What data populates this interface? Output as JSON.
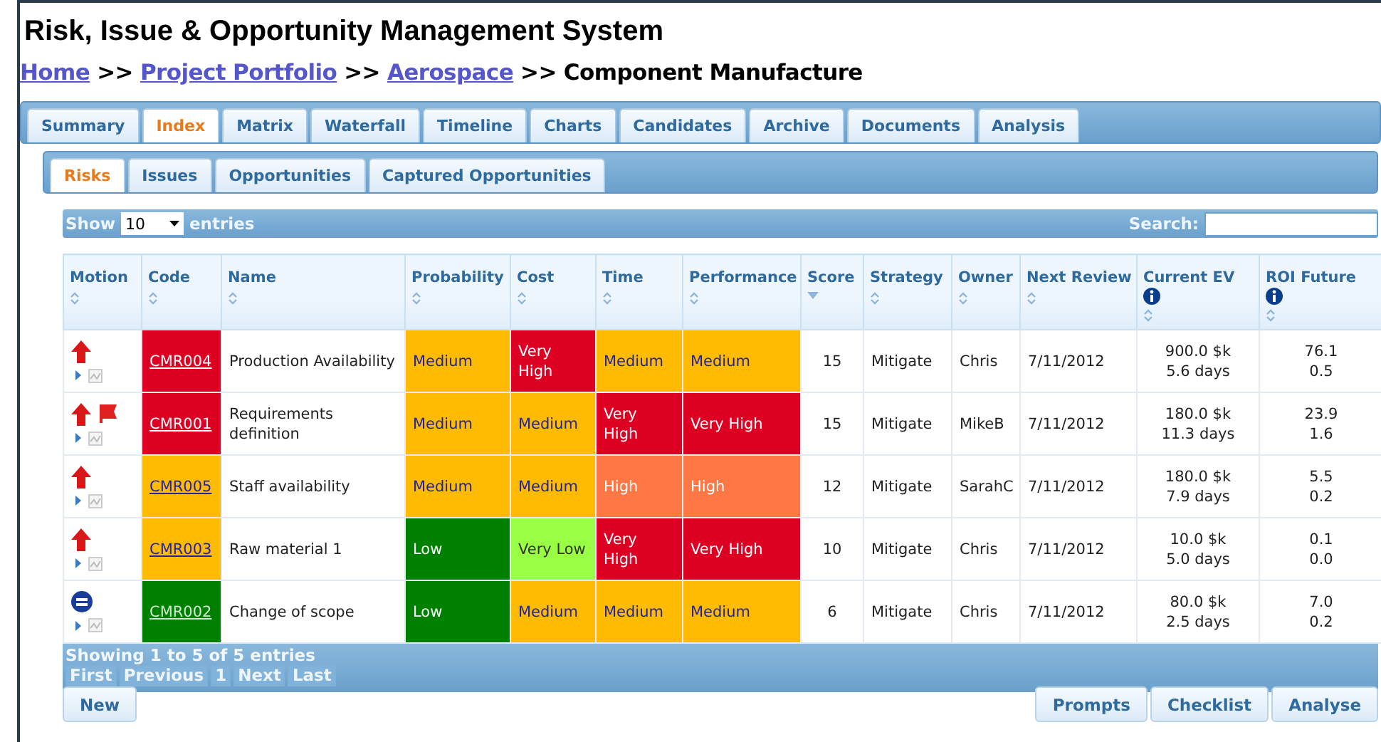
{
  "title": "Risk, Issue & Opportunity Management System",
  "breadcrumb": [
    {
      "label": "Home",
      "link": true
    },
    {
      "label": "Project Portfolio",
      "link": true
    },
    {
      "label": "Aerospace",
      "link": true
    },
    {
      "label": "Component Manufacture",
      "link": false
    }
  ],
  "separator": ">>",
  "tabs": [
    {
      "label": "Summary",
      "selected": false
    },
    {
      "label": "Index",
      "selected": true
    },
    {
      "label": "Matrix",
      "selected": false
    },
    {
      "label": "Waterfall",
      "selected": false
    },
    {
      "label": "Timeline",
      "selected": false
    },
    {
      "label": "Charts",
      "selected": false
    },
    {
      "label": "Candidates",
      "selected": false
    },
    {
      "label": "Archive",
      "selected": false
    },
    {
      "label": "Documents",
      "selected": false
    },
    {
      "label": "Analysis",
      "selected": false
    }
  ],
  "subtabs": [
    {
      "label": "Risks",
      "selected": true
    },
    {
      "label": "Issues",
      "selected": false
    },
    {
      "label": "Opportunities",
      "selected": false
    },
    {
      "label": "Captured Opportunities",
      "selected": false
    }
  ],
  "length_control": {
    "before": "Show",
    "value": "10",
    "after": "entries"
  },
  "search": {
    "label": "Search:"
  },
  "table": {
    "columns": [
      {
        "label": "Motion",
        "sorted": false,
        "info": false
      },
      {
        "label": "Code",
        "sorted": false,
        "info": false
      },
      {
        "label": "Name",
        "sorted": false,
        "info": false
      },
      {
        "label": "Probability",
        "sorted": false,
        "info": false
      },
      {
        "label": "Cost",
        "sorted": false,
        "info": false
      },
      {
        "label": "Time",
        "sorted": false,
        "info": false
      },
      {
        "label": "Performance",
        "sorted": false,
        "info": false
      },
      {
        "label": "Score",
        "sorted": true,
        "info": false
      },
      {
        "label": "Strategy",
        "sorted": false,
        "info": false
      },
      {
        "label": "Owner",
        "sorted": false,
        "info": false
      },
      {
        "label": "Next Review",
        "sorted": false,
        "info": false
      },
      {
        "label": "Current EV",
        "sorted": false,
        "info": true
      },
      {
        "label": "ROI Future",
        "sorted": false,
        "info": true
      }
    ],
    "rows": [
      {
        "kind": "up",
        "flag": false,
        "code": {
          "text": "CMR004",
          "color": "#dd0022"
        },
        "name": "Production Availability",
        "ratings": [
          {
            "text": "Medium",
            "color": "#ffbb00"
          },
          {
            "text": "Very High",
            "color": "#dd0022"
          },
          {
            "text": "Medium",
            "color": "#ffbb00"
          },
          {
            "text": "Medium",
            "color": "#ffbb00"
          }
        ],
        "score": "15",
        "strategy": "Mitigate",
        "owner": "Chris",
        "review": "7/11/2012",
        "ev": [
          "900.0 $k",
          "5.6 days"
        ],
        "roi": [
          "76.1",
          "0.5"
        ]
      },
      {
        "kind": "up",
        "flag": true,
        "code": {
          "text": "CMR001",
          "color": "#dd0022"
        },
        "name": "Requirements definition",
        "ratings": [
          {
            "text": "Medium",
            "color": "#ffbb00"
          },
          {
            "text": "Medium",
            "color": "#ffbb00"
          },
          {
            "text": "Very High",
            "color": "#dd0022"
          },
          {
            "text": "Very High",
            "color": "#dd0022"
          }
        ],
        "score": "15",
        "strategy": "Mitigate",
        "owner": "MikeB",
        "review": "7/11/2012",
        "ev": [
          "180.0 $k",
          "11.3 days"
        ],
        "roi": [
          "23.9",
          "1.6"
        ]
      },
      {
        "kind": "up",
        "flag": false,
        "code": {
          "text": "CMR005",
          "color": "#ffbb00"
        },
        "name": "Staff availability",
        "ratings": [
          {
            "text": "Medium",
            "color": "#ffbb00"
          },
          {
            "text": "Medium",
            "color": "#ffbb00"
          },
          {
            "text": "High",
            "color": "#ff7744"
          },
          {
            "text": "High",
            "color": "#ff7744"
          }
        ],
        "score": "12",
        "strategy": "Mitigate",
        "owner": "SarahC",
        "review": "7/11/2012",
        "ev": [
          "180.0 $k",
          "7.9 days"
        ],
        "roi": [
          "5.5",
          "0.2"
        ]
      },
      {
        "kind": "up",
        "flag": false,
        "code": {
          "text": "CMR003",
          "color": "#ffbb00"
        },
        "name": "Raw material 1",
        "ratings": [
          {
            "text": "Low",
            "color": "#008000"
          },
          {
            "text": "Very Low",
            "color": "#99ff44"
          },
          {
            "text": "Very High",
            "color": "#dd0022"
          },
          {
            "text": "Very High",
            "color": "#dd0022"
          }
        ],
        "score": "10",
        "strategy": "Mitigate",
        "owner": "Chris",
        "review": "7/11/2012",
        "ev": [
          "10.0 $k",
          "5.0 days"
        ],
        "roi": [
          "0.1",
          "0.0"
        ]
      },
      {
        "kind": "steady",
        "flag": false,
        "code": {
          "text": "CMR002",
          "color": "#008000"
        },
        "name": "Change of scope",
        "ratings": [
          {
            "text": "Low",
            "color": "#008000"
          },
          {
            "text": "Medium",
            "color": "#ffbb00"
          },
          {
            "text": "Medium",
            "color": "#ffbb00"
          },
          {
            "text": "Medium",
            "color": "#ffbb00"
          }
        ],
        "score": "6",
        "strategy": "Mitigate",
        "owner": "Chris",
        "review": "7/11/2012",
        "ev": [
          "80.0 $k",
          "2.5 days"
        ],
        "roi": [
          "7.0",
          "0.2"
        ]
      }
    ]
  },
  "info": "Showing 1 to 5 of 5 entries",
  "pagination": [
    {
      "label": "First",
      "disabled": true
    },
    {
      "label": "Previous",
      "disabled": true
    },
    {
      "label": "1",
      "disabled": true
    },
    {
      "label": "Next",
      "disabled": true
    },
    {
      "label": "Last",
      "disabled": true
    }
  ],
  "left_buttons": [
    "New"
  ],
  "right_buttons": [
    "Prompts",
    "Checklist",
    "Analyse"
  ]
}
